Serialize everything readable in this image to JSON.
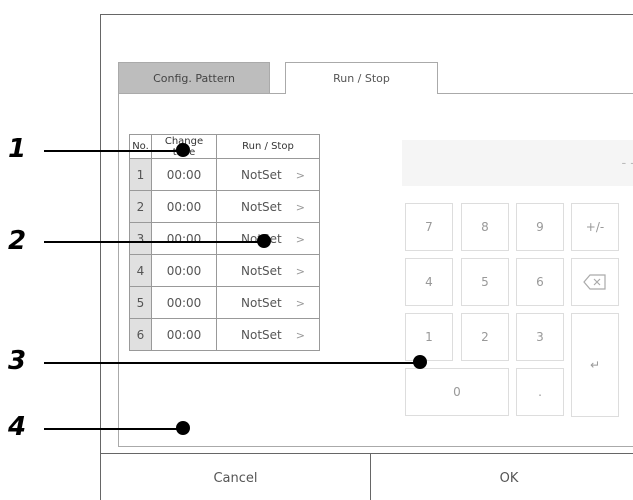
{
  "tabs": [
    {
      "label": "Config. Pattern",
      "active": false
    },
    {
      "label": "Run / Stop",
      "active": true
    }
  ],
  "table": {
    "headers": {
      "no": "No.",
      "time": "Change time",
      "run": "Run / Stop"
    },
    "rows": [
      {
        "no": "1",
        "time": "00:00",
        "run": "NotSet"
      },
      {
        "no": "2",
        "time": "00:00",
        "run": "NotSet"
      },
      {
        "no": "3",
        "time": "00:00",
        "run": "NotSet"
      },
      {
        "no": "4",
        "time": "00:00",
        "run": "NotSet"
      },
      {
        "no": "5",
        "time": "00:00",
        "run": "NotSet"
      },
      {
        "no": "6",
        "time": "00:00",
        "run": "NotSet"
      }
    ],
    "chevron": ">"
  },
  "display": {
    "value": "- -"
  },
  "keypad": {
    "k7": "7",
    "k8": "8",
    "k9": "9",
    "plusminus": "+/-",
    "k4": "4",
    "k5": "5",
    "k6": "6",
    "backspace_icon": "backspace-icon",
    "k1": "1",
    "k2": "2",
    "k3": "3",
    "enter": "↵",
    "k0": "0",
    "dot": "."
  },
  "footer": {
    "cancel_label": "Cancel",
    "ok_label": "OK"
  },
  "callouts": {
    "c1": "1",
    "c2": "2",
    "c3": "3",
    "c4": "4"
  }
}
